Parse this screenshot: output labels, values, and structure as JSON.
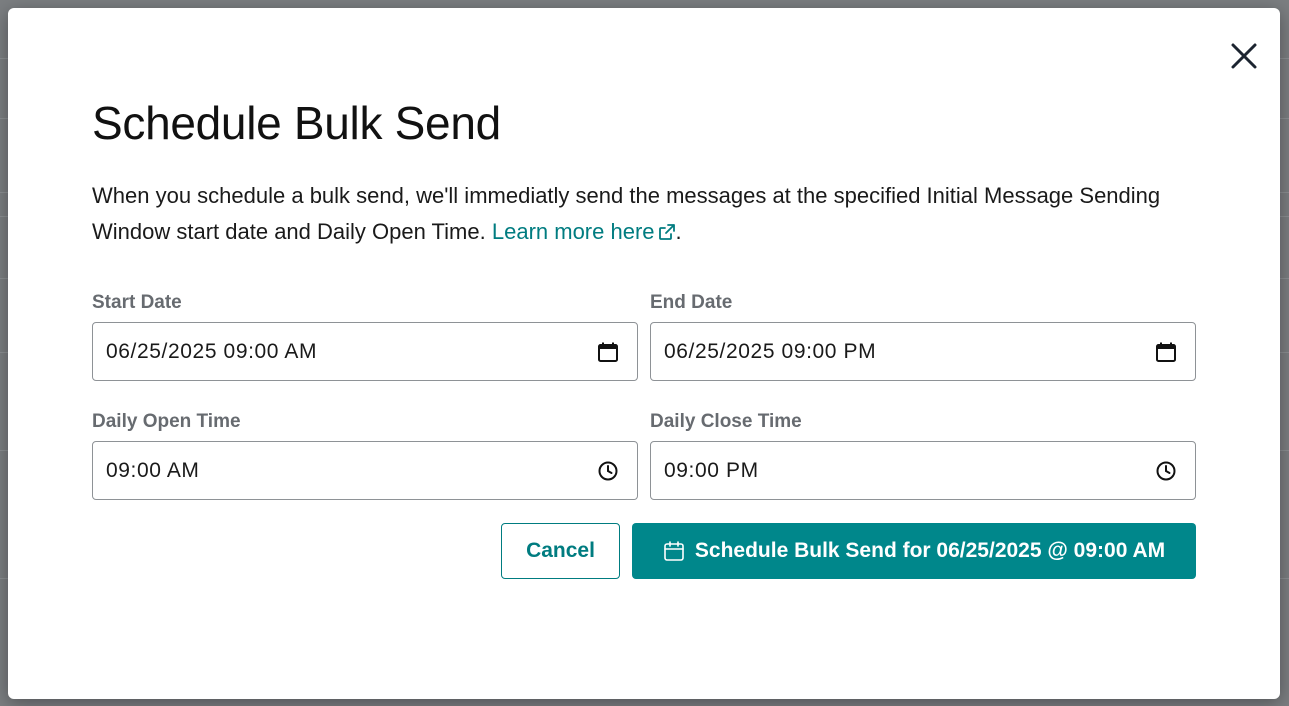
{
  "modal": {
    "title": "Schedule Bulk Send",
    "description": "When you schedule a bulk send, we'll immediatly send the messages at the specified Initial Message Sending Window start date and Daily Open Time.",
    "link_text": "Learn more here",
    "description_end": "."
  },
  "fields": {
    "start_date": {
      "label": "Start Date",
      "value": "06/25/2025 09:00 AM",
      "icon": "calendar-icon"
    },
    "end_date": {
      "label": "End Date",
      "value": "06/25/2025 09:00 PM",
      "icon": "calendar-icon"
    },
    "daily_open": {
      "label": "Daily Open Time",
      "value": "09:00 AM",
      "icon": "clock-icon"
    },
    "daily_close": {
      "label": "Daily Close Time",
      "value": "09:00 PM",
      "icon": "clock-icon"
    }
  },
  "buttons": {
    "cancel": "Cancel",
    "schedule": "Schedule Bulk Send for 06/25/2025 @ 09:00 AM"
  },
  "colors": {
    "accent": "#00878b",
    "link": "#007c80"
  }
}
